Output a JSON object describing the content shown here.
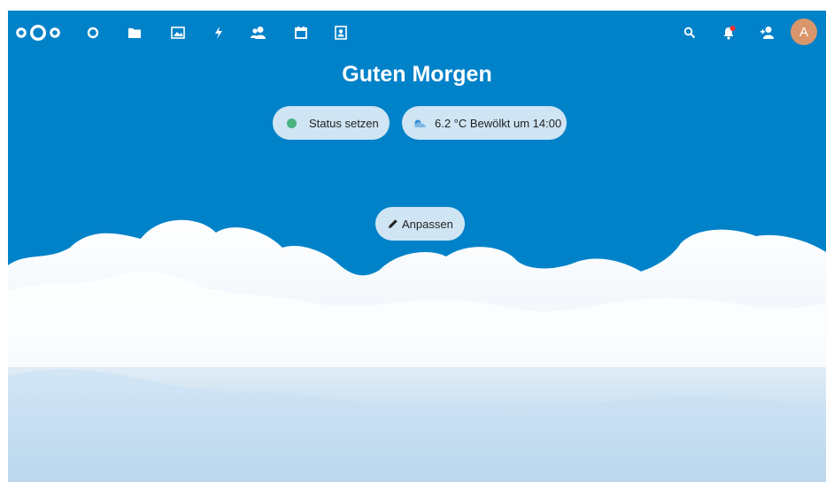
{
  "header": {
    "nav_icons": [
      "dashboard-icon",
      "files-icon",
      "photos-icon",
      "activity-icon",
      "contacts-icon",
      "calendar-icon",
      "contacts-book-icon"
    ],
    "right_icons": [
      "search-icon",
      "notifications-icon",
      "contacts-menu-icon"
    ],
    "avatar_initial": "A",
    "notification_badge_color": "#e9322d"
  },
  "main": {
    "greeting": "Guten Morgen",
    "status_label": "Status setzen",
    "status_color": "#49b382",
    "weather_label": "6.2 °C Bewölkt um 14:00",
    "customize_label": "Anpassen"
  },
  "theme": {
    "primary": "#0082c9",
    "pill_bg": "#e1eef7"
  }
}
